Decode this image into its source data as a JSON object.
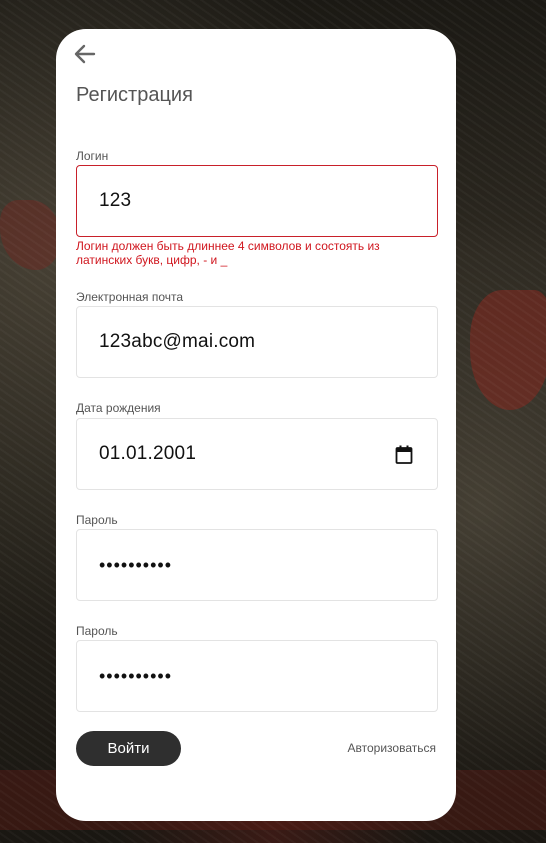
{
  "form": {
    "title": "Регистрация",
    "login": {
      "label": "Логин",
      "value": "123",
      "error": "Логин должен быть длиннее 4 символов и состоять из латинских букв, цифр, - и _"
    },
    "email": {
      "label": "Электронная почта",
      "value": "123abc@mai.com"
    },
    "birthdate": {
      "label": "Дата рождения",
      "value": "01.01.2001"
    },
    "password": {
      "label": "Пароль",
      "value": "••••••••••"
    },
    "password_repeat": {
      "label": "Пароль",
      "value": "••••••••••"
    },
    "submit_label": "Войти",
    "login_link": "Авторизоваться"
  },
  "colors": {
    "error": "#d0161e",
    "button": "#2f2f2f",
    "card": "#ffffff"
  },
  "icons": {
    "back": "arrow-left-icon",
    "calendar": "calendar-icon"
  }
}
